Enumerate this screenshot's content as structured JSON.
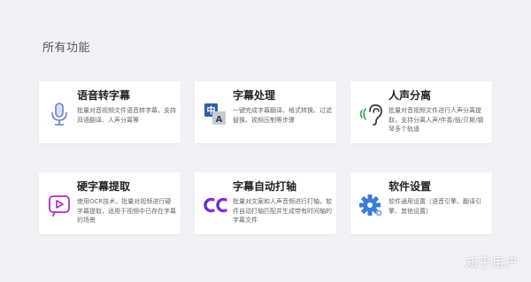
{
  "section": {
    "title": "所有功能"
  },
  "cards": [
    {
      "title": "语音转字幕",
      "desc": "批量对音视频文件语音转字幕，支持双语翻译、人声分离等",
      "icon": "microphone-icon"
    },
    {
      "title": "字幕处理",
      "desc": "一键完成字幕翻译、格式转换、过滤替换、视频压制等步骤",
      "icon": "translate-icon"
    },
    {
      "title": "人声分离",
      "desc": "批量对音视频文件进行人声分离提取，支持分离人声/伴奏/鼓/贝斯/钢琴多个轨道",
      "icon": "ear-icon"
    },
    {
      "title": "硬字幕提取",
      "desc": "使用OCR技术，批量对视频进行硬字幕提取，适用于视频中已存在字幕的场景",
      "icon": "video-subtitle-icon"
    },
    {
      "title": "字幕自动打轴",
      "desc": "批量对文案和人声音频进行打轴，软件自动打轴匹配并生成带有时间轴的字幕文件",
      "icon": "cc-icon"
    },
    {
      "title": "软件设置",
      "desc": "软件通用设置（语音引擎、翻译引擎、其他设置）",
      "icon": "gear-icon"
    }
  ],
  "watermark": {
    "text": "知乎用户"
  },
  "colors": {
    "background": "#f2f2f6",
    "card": "#ffffff",
    "mic_blue": "#6b7fd4",
    "translate_navy": "#2f5fa8",
    "ear_green": "#2fa84f",
    "video_purple": "#b02ac2",
    "cc_purple": "#7b2fd6",
    "gear_blue": "#3b7dd8"
  }
}
